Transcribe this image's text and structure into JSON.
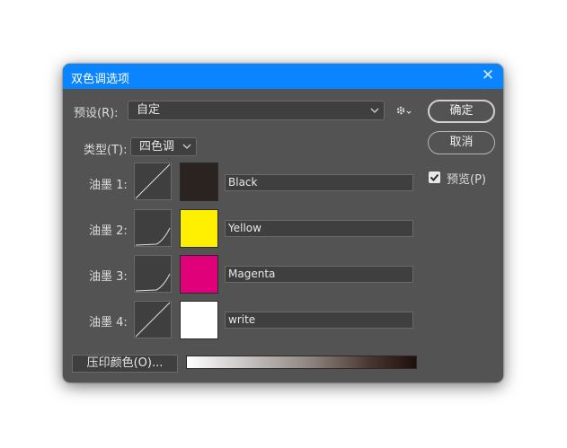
{
  "dialog": {
    "title": "双色调选项",
    "close_glyph": "✕"
  },
  "preset": {
    "label": "预设(R):",
    "value": "自定"
  },
  "type": {
    "label": "类型(T):",
    "value": "四色调"
  },
  "inks": [
    {
      "label": "油墨 1:",
      "name": "Black",
      "color": "#2b2320",
      "curve": "linear"
    },
    {
      "label": "油墨 2:",
      "name": "Yellow",
      "color": "#ffef00",
      "curve": "concave"
    },
    {
      "label": "油墨 3:",
      "name": "Magenta",
      "color": "#e0007a",
      "curve": "concave"
    },
    {
      "label": "油墨 4:",
      "name": "write",
      "color": "#ffffff",
      "curve": "linear"
    }
  ],
  "buttons": {
    "ok": "确定",
    "cancel": "取消",
    "overprint": "压印颜色(O)..."
  },
  "preview": {
    "label": "预览(P)",
    "checked": true
  },
  "colors": {
    "accent": "#0a84ff",
    "panel": "#535353"
  }
}
